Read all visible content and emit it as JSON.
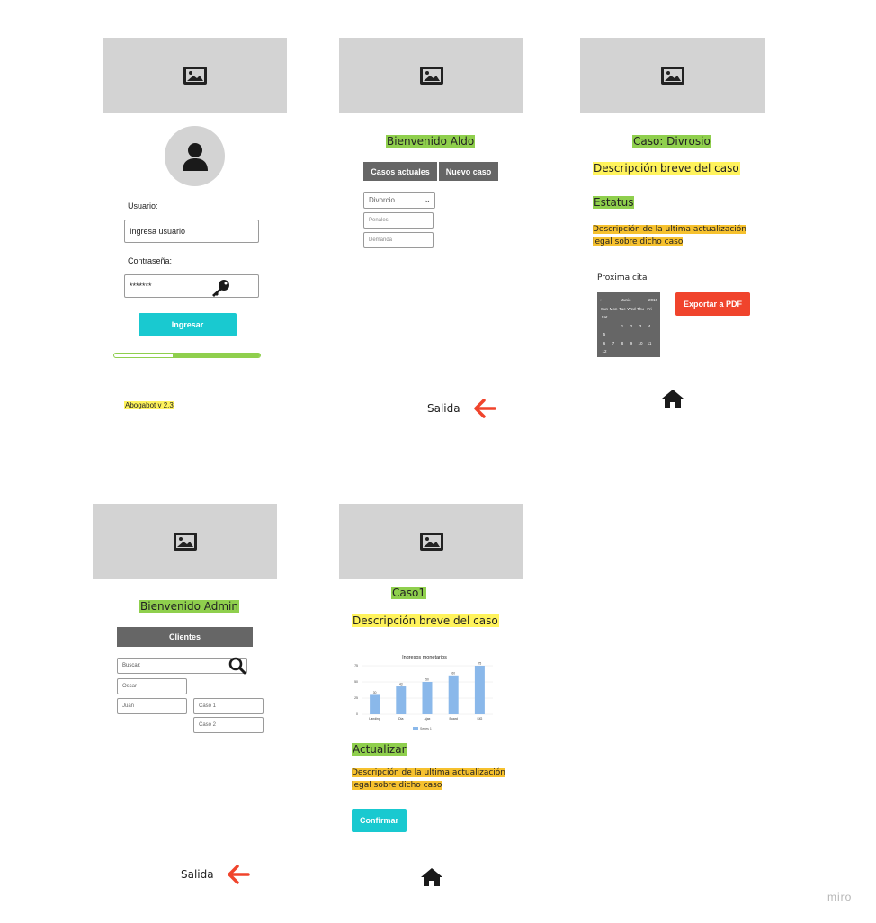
{
  "login": {
    "username_label": "Usuario:",
    "username_value": "Ingresa usuario",
    "password_label": "Contraseña:",
    "password_value": "*******",
    "submit_label": "Ingresar",
    "version": "Abogabot v 2.3"
  },
  "welcome": {
    "title": "Bienvenido Aldo",
    "tab_current": "Casos actuales",
    "tab_new": "Nuevo caso",
    "dropdown_value": "Divorcio",
    "field1": "Penales",
    "field2": "Demanda",
    "exit_label": "Salida"
  },
  "case_detail": {
    "title": "Caso: Divrosio",
    "description": "Descripción breve del caso",
    "status_label": "Estatus",
    "update_desc_line1": "Descripción de la ultima actualización",
    "update_desc_line2": "legal sobre dicho caso",
    "next_date_label": "Proxima cita",
    "export_label": "Exportar a PDF",
    "calendar": {
      "month": "Junio",
      "year": "2016",
      "weekdays": [
        "Sun",
        "Mon",
        "Tue",
        "Wed",
        "Thu",
        "Fri",
        "Sat"
      ],
      "weeks": [
        [
          "",
          "",
          "1",
          "2",
          "3",
          "4",
          "5"
        ],
        [
          "6",
          "7",
          "8",
          "9",
          "10",
          "11",
          "12"
        ],
        [
          "13",
          "14",
          "15",
          "16",
          "17",
          "18",
          "19"
        ],
        [
          "20",
          "21",
          "22",
          "23",
          "24",
          "25",
          "26"
        ],
        [
          "27",
          "28",
          "29",
          "30",
          "",
          "",
          ""
        ]
      ]
    }
  },
  "admin": {
    "title": "Bienvenido Admin",
    "clients_label": "Clientes",
    "search_placeholder": "Buscar:",
    "client1": "Oscar",
    "client2": "Juan",
    "case1": "Caso 1",
    "case2": "Caso 2",
    "exit_label": "Salida"
  },
  "case_admin": {
    "title": "Caso1",
    "description": "Descripción breve del caso",
    "update_label": "Actualizar",
    "update_desc_line1": "Descripción de la ultima actualización",
    "update_desc_line2": "legal sobre dicho caso",
    "confirm_label": "Confirmar"
  },
  "chart_data": {
    "type": "bar",
    "title": "Ingresos monetarios",
    "categories": [
      "Landing",
      "Dia",
      "Ajax",
      "Board",
      "SIG"
    ],
    "series": [
      {
        "name": "Series 1",
        "values": [
          30,
          43,
          50,
          60,
          75
        ]
      }
    ],
    "ylim": [
      0,
      75
    ],
    "yticks": [
      "0",
      "25",
      "50",
      "75"
    ],
    "legend": "bottom",
    "bar_color": "#8ab8ea"
  },
  "watermark": "miro",
  "colors": {
    "placeholder_gray": "#d3d3d3",
    "highlight_green": "#8fcf4d",
    "highlight_yellow": "#fff35c",
    "highlight_orange": "#f6c12e",
    "accent_cyan": "#19c9d0",
    "accent_red": "#f0442c",
    "progress_green": "#8fcf4d"
  },
  "progress": {
    "fraction": 0.6
  }
}
